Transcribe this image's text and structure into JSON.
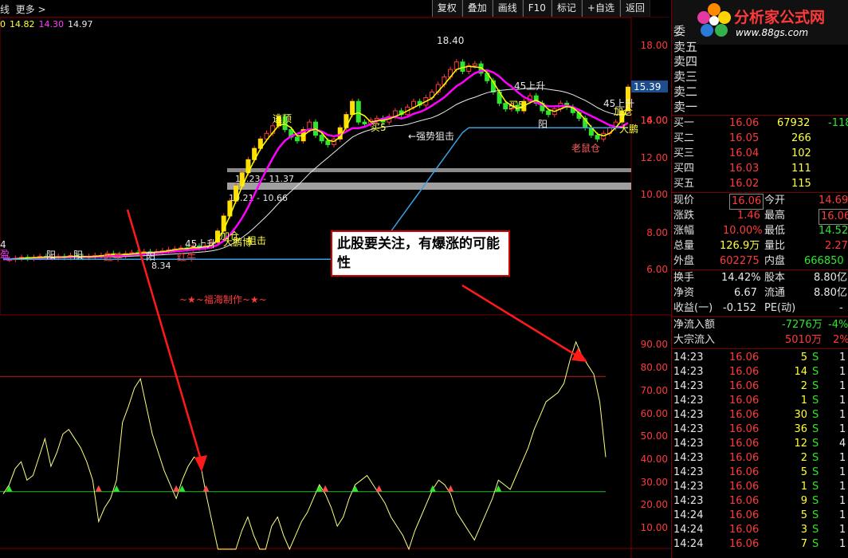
{
  "topbar": {
    "title": "线  更多 >",
    "toolbar": [
      "复权",
      "叠加",
      "画线",
      "F10",
      "标记",
      "+自选",
      "返回"
    ],
    "legend": [
      "0",
      "14.82",
      "14.30",
      "14.97"
    ]
  },
  "colors": {
    "background": "#000000",
    "up": "#ff3a3a",
    "down": "#2ee62e",
    "ma_main": "#ff00ff",
    "ma_yellow": "#ffff00",
    "ma_white": "#e8e8e8",
    "support": "#3aa0e0",
    "callout_border": "#d00000"
  },
  "price_axis": [
    "18.00",
    "16.00",
    "14.00",
    "12.00",
    "10.00",
    "8.00",
    "6.00"
  ],
  "price_tag": "15.39",
  "indicator_axis": [
    "90.00",
    "80.00",
    "70.00",
    "60.00",
    "50.00",
    "40.00",
    "30.00",
    "20.00",
    "10.00"
  ],
  "annotations": {
    "high": "18.40",
    "low": "8.34",
    "gap1": "11.23 - 11.37",
    "gap2": "10.21 - 10.66",
    "signal_strong": "←强势狙击",
    "signal_sell": "逃顶",
    "signal_buy5": "买5",
    "signal_buy5b": "买5",
    "signal_45": "45上升",
    "signal_45b": "45上升",
    "signal_yang": "阳",
    "signal_yang2": "阳",
    "signal_yang3": "阳",
    "signal_mouse": "老鼠仓",
    "signal_red1": "红牛",
    "signal_red2": "红牛",
    "signal_big": "大鹏博",
    "signal_big2": "大鹏",
    "signal_add": "加仓",
    "signal_add2": "加仓",
    "signal_left": "45上升",
    "signal_left2": "4",
    "signal_hit": "狙击",
    "signal_yang4": "阳",
    "signal_ying": "盈",
    "maker": "~★~福海制作~★~",
    "callout": "此股要关注，有爆涨的可能性"
  },
  "quote": {
    "logo": "分析家公式网",
    "logo_url": "www.88gs.com",
    "asks": [
      "委",
      "卖五",
      "卖四",
      "卖三",
      "卖二",
      "卖一"
    ],
    "bids": [
      {
        "label": "买一",
        "price": "16.06",
        "vol": "67932",
        "chg": "-118"
      },
      {
        "label": "买二",
        "price": "16.05",
        "vol": "266",
        "chg": ""
      },
      {
        "label": "买三",
        "price": "16.04",
        "vol": "102",
        "chg": ""
      },
      {
        "label": "买四",
        "price": "16.03",
        "vol": "111",
        "chg": ""
      },
      {
        "label": "买五",
        "price": "16.02",
        "vol": "115",
        "chg": ""
      }
    ],
    "stats": [
      {
        "l1": "现价",
        "v1": "16.06",
        "l2": "今开",
        "v2": "14.69"
      },
      {
        "l1": "涨跌",
        "v1": "1.46",
        "l2": "最高",
        "v2": "16.06"
      },
      {
        "l1": "涨幅",
        "v1": "10.00%",
        "l2": "最低",
        "v2": "14.52"
      },
      {
        "l1": "总量",
        "v1": "126.9万",
        "l2": "量比",
        "v2": "2.27"
      },
      {
        "l1": "外盘",
        "v1": "602275",
        "l2": "内盘",
        "v2": "666850"
      }
    ],
    "fund": [
      {
        "l1": "换手",
        "v1": "14.42%",
        "l2": "股本",
        "v2": "8.80亿"
      },
      {
        "l1": "净资",
        "v1": "6.67",
        "l2": "流通",
        "v2": "8.80亿"
      },
      {
        "l1": "收益(一)",
        "v1": "-0.152",
        "l2": "PE(动)",
        "v2": "-"
      }
    ],
    "flow": [
      {
        "label": "净流入额",
        "value": "-7276万",
        "pct": "-4%"
      },
      {
        "label": "大宗流入",
        "value": "5010万",
        "pct": "2%"
      }
    ],
    "ticks": [
      {
        "t": "14:23",
        "p": "16.06",
        "v": "5",
        "s": "S",
        "n": "1"
      },
      {
        "t": "14:23",
        "p": "16.06",
        "v": "14",
        "s": "S",
        "n": "1"
      },
      {
        "t": "14:23",
        "p": "16.06",
        "v": "2",
        "s": "S",
        "n": "1"
      },
      {
        "t": "14:23",
        "p": "16.06",
        "v": "1",
        "s": "S",
        "n": "1"
      },
      {
        "t": "14:23",
        "p": "16.06",
        "v": "30",
        "s": "S",
        "n": "1"
      },
      {
        "t": "14:23",
        "p": "16.06",
        "v": "36",
        "s": "S",
        "n": "1"
      },
      {
        "t": "14:23",
        "p": "16.06",
        "v": "12",
        "s": "S",
        "n": "4"
      },
      {
        "t": "14:23",
        "p": "16.06",
        "v": "2",
        "s": "S",
        "n": "1"
      },
      {
        "t": "14:23",
        "p": "16.06",
        "v": "5",
        "s": "S",
        "n": "1"
      },
      {
        "t": "14:23",
        "p": "16.06",
        "v": "1",
        "s": "S",
        "n": "1"
      },
      {
        "t": "14:23",
        "p": "16.06",
        "v": "9",
        "s": "S",
        "n": "1"
      },
      {
        "t": "14:24",
        "p": "16.06",
        "v": "5",
        "s": "S",
        "n": "1"
      },
      {
        "t": "14:24",
        "p": "16.06",
        "v": "3",
        "s": "S",
        "n": "1"
      },
      {
        "t": "14:24",
        "p": "16.06",
        "v": "7",
        "s": "S",
        "n": "1"
      }
    ]
  },
  "chart_data": {
    "type": "candlestick",
    "title": "",
    "price_range": [
      5.0,
      19.0
    ],
    "indicator_range": [
      0,
      100
    ],
    "indicator_levels": [
      25,
      75
    ],
    "closes": [
      6.9,
      6.9,
      6.95,
      7.0,
      6.95,
      7.0,
      7.05,
      7.0,
      7.0,
      7.05,
      7.0,
      7.1,
      7.05,
      7.0,
      7.05,
      7.1,
      7.1,
      7.2,
      7.15,
      7.1,
      7.2,
      7.25,
      7.2,
      7.3,
      7.25,
      7.3,
      7.35,
      7.4,
      7.45,
      7.5,
      7.45,
      7.6,
      7.5,
      7.6,
      7.8,
      8.4,
      9.2,
      10.0,
      10.8,
      11.5,
      12.2,
      12.8,
      13.3,
      13.6,
      14.0,
      14.5,
      13.8,
      13.4,
      13.2,
      13.8,
      14.2,
      13.5,
      13.2,
      13.0,
      13.3,
      13.9,
      14.6,
      15.3,
      14.2,
      14.1,
      14.3,
      14.4,
      14.2,
      14.5,
      14.8,
      14.6,
      15.0,
      15.3,
      15.1,
      15.5,
      15.8,
      16.2,
      16.6,
      17.0,
      17.4,
      16.9,
      17.2,
      17.3,
      16.8,
      16.4,
      15.8,
      15.2,
      14.9,
      15.1,
      14.8,
      15.3,
      15.6,
      15.2,
      14.8,
      14.6,
      14.9,
      15.2,
      15.0,
      14.7,
      14.4,
      13.9,
      13.5,
      13.3,
      13.6,
      13.9,
      14.2,
      14.8,
      16.06
    ],
    "indicator": [
      24,
      28,
      35,
      38,
      30,
      32,
      40,
      48,
      36,
      42,
      50,
      52,
      48,
      44,
      38,
      30,
      12,
      18,
      22,
      30,
      55,
      62,
      70,
      74,
      62,
      50,
      42,
      34,
      28,
      22,
      30,
      36,
      40,
      38,
      24,
      12,
      0,
      0,
      0,
      0,
      8,
      14,
      6,
      0,
      0,
      10,
      14,
      6,
      0,
      6,
      12,
      16,
      22,
      28,
      24,
      18,
      10,
      14,
      22,
      28,
      30,
      32,
      28,
      24,
      20,
      14,
      10,
      6,
      0,
      8,
      14,
      20,
      26,
      30,
      28,
      24,
      16,
      12,
      8,
      4,
      10,
      16,
      22,
      30,
      28,
      26,
      32,
      38,
      44,
      52,
      58,
      64,
      66,
      68,
      72,
      82,
      90,
      84,
      80,
      76,
      64,
      40
    ]
  }
}
